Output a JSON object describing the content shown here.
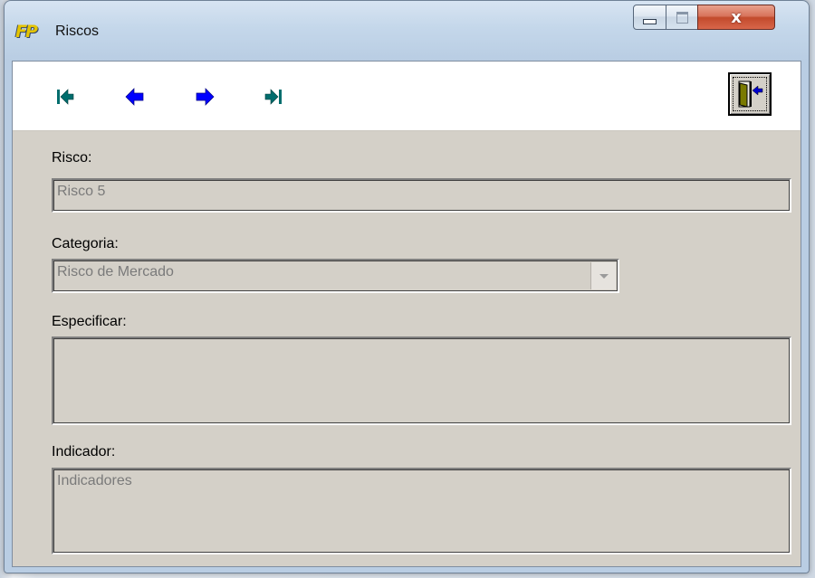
{
  "window": {
    "title": "Riscos",
    "logo_text": "FP",
    "close_glyph": "x"
  },
  "toolbar": {
    "buttons": [
      {
        "name": "first-record",
        "icon": "arrow-first-icon",
        "color": "#006d6d"
      },
      {
        "name": "previous-record",
        "icon": "arrow-left-icon",
        "color": "#0000ff"
      },
      {
        "name": "next-record",
        "icon": "arrow-right-icon",
        "color": "#0000ff"
      },
      {
        "name": "last-record",
        "icon": "arrow-last-icon",
        "color": "#006d6d"
      }
    ],
    "exit_icon": "door-exit-icon"
  },
  "form": {
    "risco_label": "Risco:",
    "risco_value": "Risco 5",
    "categoria_label": "Categoria:",
    "categoria_value": "Risco de Mercado",
    "especificar_label": "Especificar:",
    "especificar_value": "",
    "indicador_label": "Indicador:",
    "indicador_value": "Indicadores"
  },
  "colors": {
    "client_bg": "#d4d0c8",
    "toolbar_bg": "#ffffff",
    "disabled_text": "#7a7a7a",
    "close_button": "#c24a2c"
  }
}
